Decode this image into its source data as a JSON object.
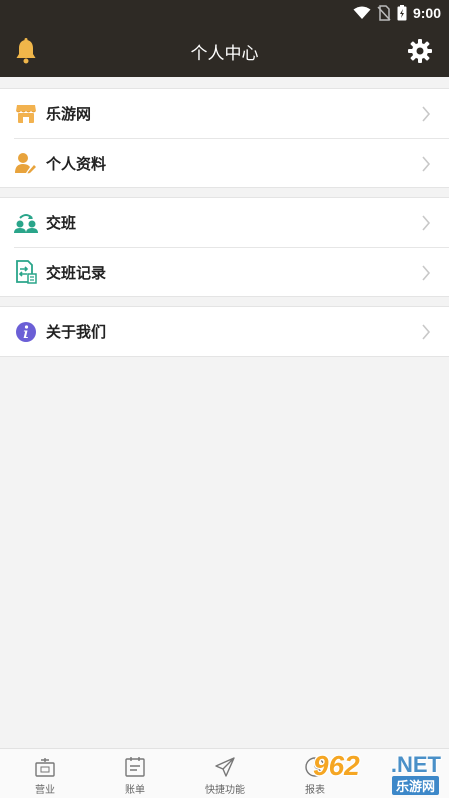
{
  "status_bar": {
    "time": "9:00"
  },
  "app_bar": {
    "title": "个人中心"
  },
  "groups": [
    {
      "items": [
        {
          "label": "乐游网",
          "icon": "store-icon"
        },
        {
          "label": "个人资料",
          "icon": "user-edit-icon"
        }
      ]
    },
    {
      "items": [
        {
          "label": "交班",
          "icon": "shift-swap-icon"
        },
        {
          "label": "交班记录",
          "icon": "shift-record-icon"
        }
      ]
    },
    {
      "items": [
        {
          "label": "关于我们",
          "icon": "info-icon"
        }
      ]
    }
  ],
  "tab_bar": [
    {
      "label": "营业",
      "icon": "register-icon"
    },
    {
      "label": "账单",
      "icon": "bill-icon"
    },
    {
      "label": "快捷功能",
      "icon": "send-icon"
    },
    {
      "label": "报表",
      "icon": "chart-icon"
    }
  ],
  "watermark": {
    "number": "962",
    "domain": ".NET",
    "name": "乐游网"
  },
  "colors": {
    "header_bg": "#2e2a25",
    "accent_orange": "#e8a33c",
    "accent_green": "#2aa58a",
    "info_purple": "#6b5fd6"
  }
}
